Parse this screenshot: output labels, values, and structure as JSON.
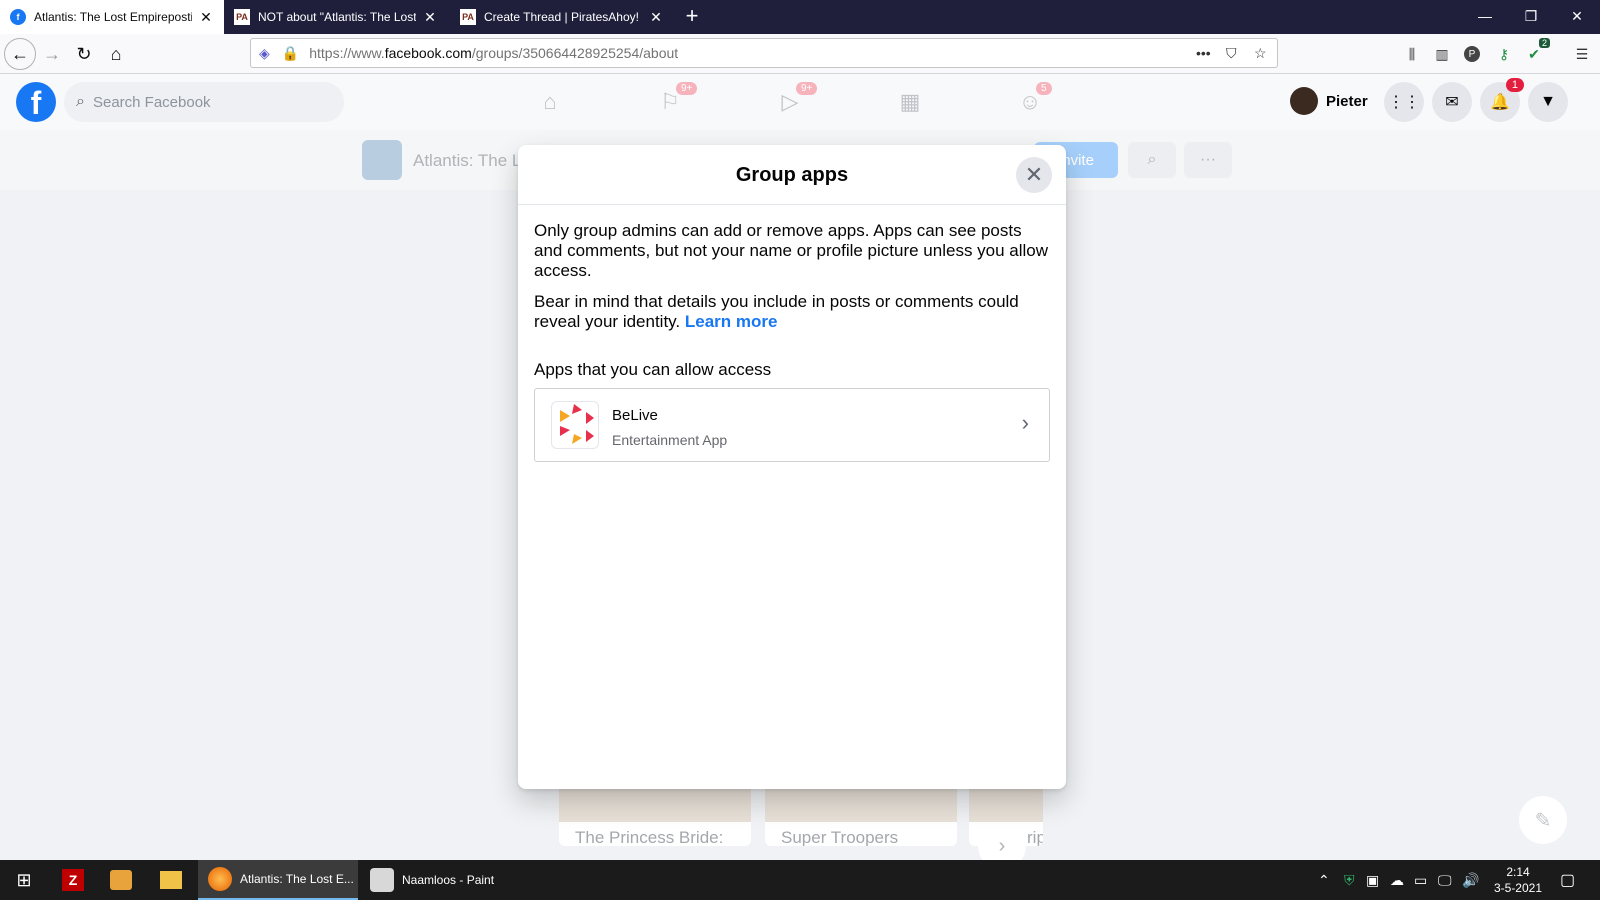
{
  "browser": {
    "tabs": [
      {
        "title": "Atlantis: The Lost Empireposting",
        "favicon": "f",
        "active": true
      },
      {
        "title": "NOT about \"Atlantis: The Lost E",
        "favicon": "PA",
        "active": false
      },
      {
        "title": "Create Thread | PiratesAhoy!",
        "favicon": "PA",
        "active": false
      }
    ],
    "new_tab": "+",
    "url_prefix": "https://www.",
    "url_host": "facebook.com",
    "url_path": "/groups/350664428925254/about",
    "win_minimize": "—",
    "win_restore": "❐",
    "win_close": "✕",
    "extension_badge": "2"
  },
  "facebook": {
    "search_placeholder": "Search Facebook",
    "nav_badges": [
      "9+",
      "9+",
      "5"
    ],
    "profile_name": "Pieter",
    "notif_count": "1",
    "group_name": "Atlantis: The L",
    "invite_label": "Invite",
    "bg_cards": [
      "The Princess Bride:",
      "Super Troopers",
      "rip"
    ]
  },
  "modal": {
    "title": "Group apps",
    "para1": "Only group admins can add or remove apps. Apps can see posts and comments, but not your name or profile picture unless you allow access.",
    "para2": "Bear in mind that details you include in posts or comments could reveal your identity.",
    "learn_more": "Learn more",
    "section_label": "Apps that you can allow access",
    "apps": [
      {
        "name": "BeLive",
        "category": "Entertainment App"
      }
    ]
  },
  "taskbar": {
    "apps": [
      {
        "label": "Atlantis: The Lost E...",
        "active": true
      },
      {
        "label": "Naamloos - Paint",
        "active": false
      }
    ],
    "time": "2:14",
    "date": "3-5-2021"
  },
  "colors": {
    "fb_blue": "#1877f2",
    "tabbar": "#1f1f3c",
    "notif_red": "#e41e3f"
  }
}
